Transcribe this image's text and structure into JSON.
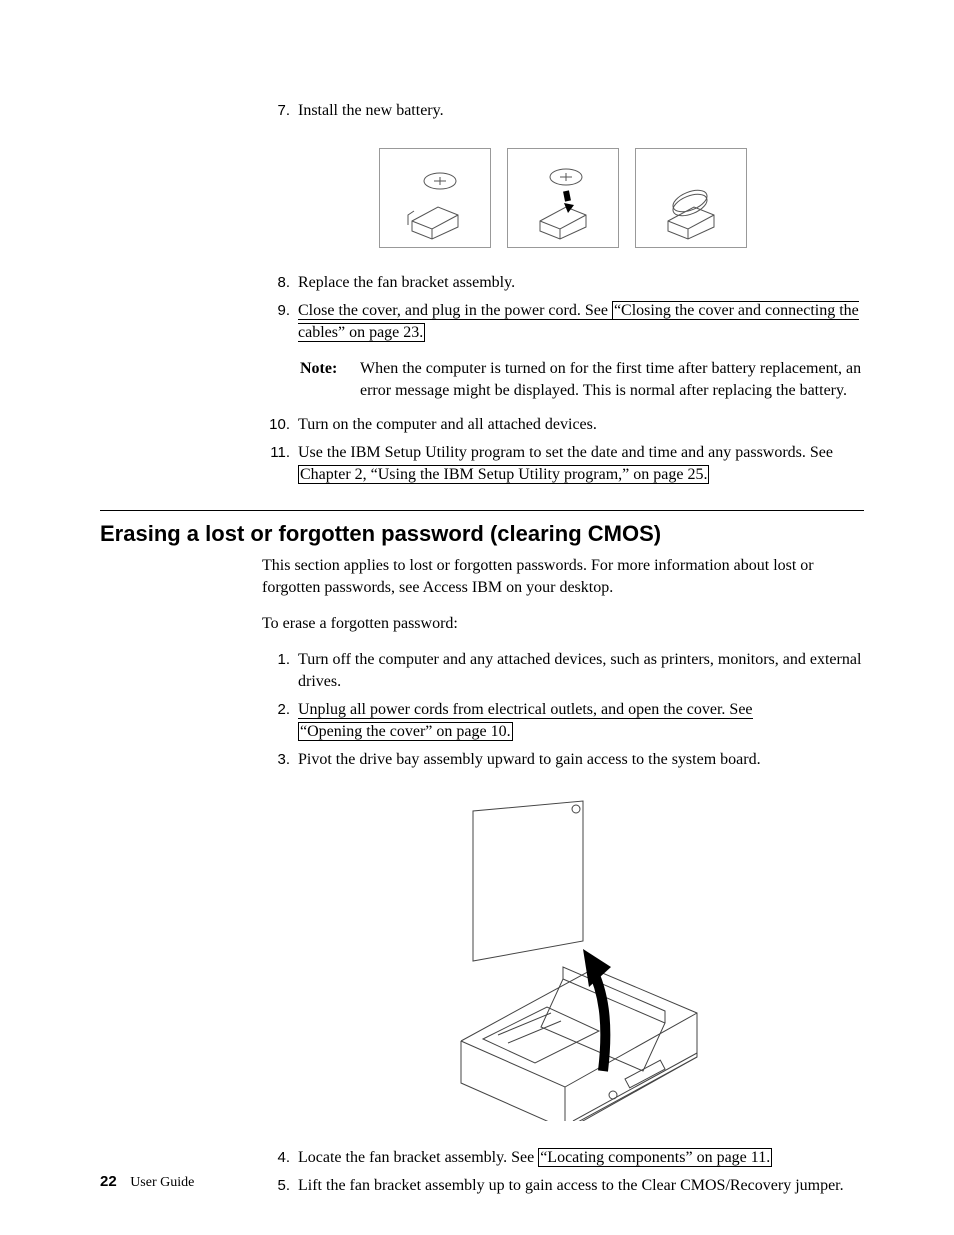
{
  "steps_top": [
    {
      "n": "7.",
      "text": "Install the new battery."
    },
    {
      "n": "8.",
      "text": "Replace the fan bracket assembly."
    },
    {
      "n": "9.",
      "pre": "Close the cover, and plug in the power cord. See ",
      "link": "“Closing the cover and connecting the cables” on page 23."
    },
    {
      "n": "10.",
      "text": "Turn on the computer and all attached devices."
    },
    {
      "n": "11.",
      "pre": "Use the IBM Setup Utility program to set the date and time and any passwords. See ",
      "link": "Chapter 2, “Using the IBM Setup Utility program,” on page 25."
    }
  ],
  "note": {
    "label": "Note:",
    "text": "When the computer is turned on for the first time after battery replacement, an error message might be displayed. This is normal after replacing the battery."
  },
  "section_title": "Erasing a lost or forgotten password (clearing CMOS)",
  "body1": "This section applies to lost or forgotten passwords. For more information about lost or forgotten passwords, see Access IBM on your desktop.",
  "body2": "To erase a forgotten password:",
  "steps_bottom": [
    {
      "n": "1.",
      "text": "Turn off the computer and any attached devices, such as printers, monitors, and external drives."
    },
    {
      "n": "2.",
      "pre": "Unplug all power cords from electrical outlets, and open the cover. See ",
      "link": "“Opening the cover” on page 10."
    },
    {
      "n": "3.",
      "text": "Pivot the drive bay assembly upward to gain access to the system board."
    },
    {
      "n": "4.",
      "pre": "Locate the fan bracket assembly. See ",
      "link": "“Locating components” on page 11."
    },
    {
      "n": "5.",
      "text": "Lift the fan bracket assembly up to gain access to the Clear CMOS/Recovery jumper."
    }
  ],
  "footer": {
    "page": "22",
    "doc": "User Guide"
  }
}
